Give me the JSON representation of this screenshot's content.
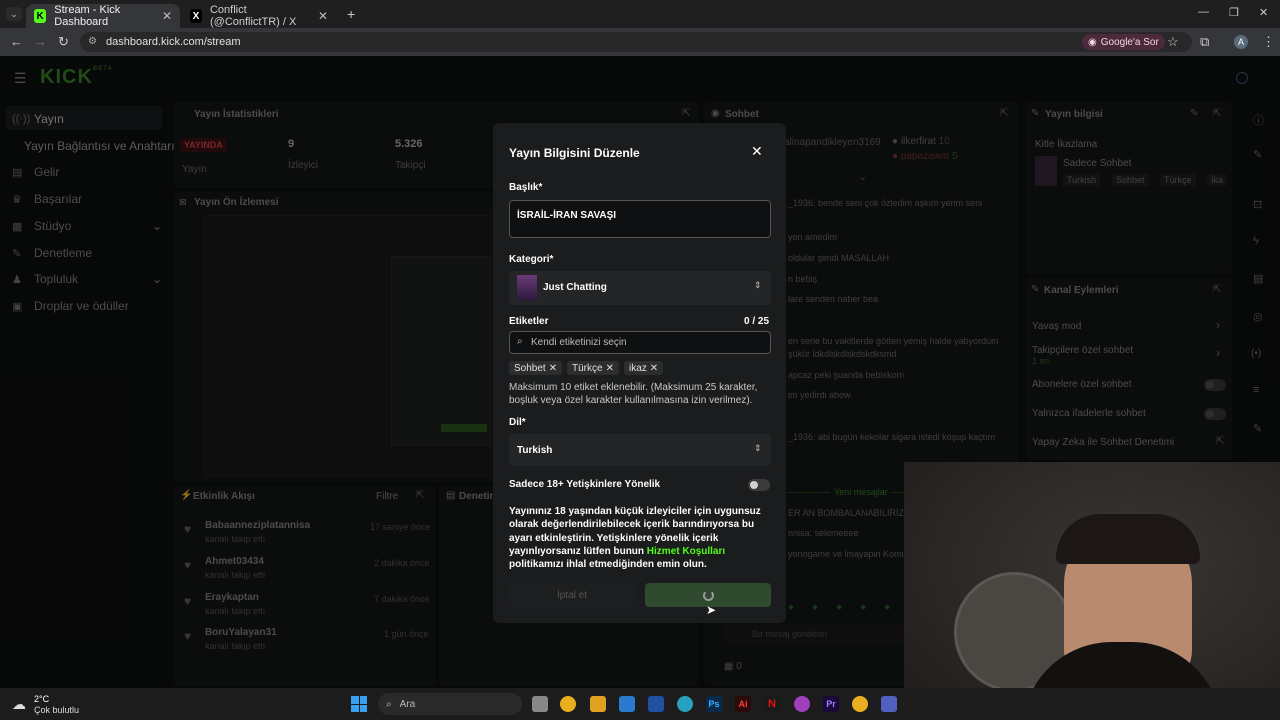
{
  "browser": {
    "tabs": [
      {
        "label": "Stream - Kick Dashboard",
        "icon": "kick-icon",
        "active": true
      },
      {
        "label": "Conflict (@ConflictTR) / X",
        "icon": "x-icon",
        "active": false
      }
    ],
    "url": "dashboard.kick.com/stream",
    "google_button": "Google'a Sor",
    "profile_letter": "A"
  },
  "app": {
    "logo": "KICK",
    "logo_badge": "BETA",
    "sidebar": {
      "items": [
        {
          "label": "Yayın",
          "icon": "broadcast-icon"
        },
        {
          "label": "Yayın Bağlantısı ve Anahtarı",
          "icon": ""
        },
        {
          "label": "Gelir",
          "icon": "money-icon"
        },
        {
          "label": "Başarılar",
          "icon": "trophy-icon"
        },
        {
          "label": "Stüdyo",
          "icon": "studio-icon",
          "chevron": true
        },
        {
          "label": "Denetleme",
          "icon": "wrench-icon"
        },
        {
          "label": "Topluluk",
          "icon": "community-icon",
          "chevron": true
        },
        {
          "label": "Droplar ve ödüller",
          "icon": "gift-icon"
        }
      ]
    },
    "stats": {
      "title": "Yayın İstatistikleri",
      "live_badge": "YAYINDA",
      "status_label": "Yayın",
      "viewers_value": "9",
      "viewers_label": "İzleyici",
      "followers_value": "5.326",
      "followers_label": "Takipçi"
    },
    "preview_title": "Yayın Ön İzlemesi",
    "activity": {
      "title": "Etkinlik Akışı",
      "filter": "Filtre",
      "items": [
        {
          "name": "Babaanneziplatannisa",
          "sub": "kanalı takip etti",
          "time": "17 saniye önce"
        },
        {
          "name": "Ahmet03434",
          "sub": "kanalı takip etti",
          "time": "2 dakika önce"
        },
        {
          "name": "Eraykaptan",
          "sub": "kanalı takip etti",
          "time": "7 dakika önce"
        },
        {
          "name": "BoruYalayan31",
          "sub": "kanalı takip etti",
          "time": "1 gün önce"
        }
      ]
    },
    "denetim_title": "Denetim",
    "chat": {
      "title": "Sohbet",
      "top_users": [
        {
          "name": "ilkerfirat",
          "count": "10"
        },
        {
          "name": "papazawm",
          "count": "5"
        }
      ],
      "partial_user": "alinapandikleyen3169",
      "lines": [
        "_1936: bende seni çok özledim aşkım yerim seni",
        "yon amedim",
        "oldular şimdi MASALLAH",
        "n bebiş",
        "lare senden naber bea",
        "en sene bu vakitlerde götten yemiş halde yabyordum",
        "şükür ldkdlskdlskdskdksmd",
        "apcaz peki şuanda bebiskom",
        "im yedirdi abow",
        "_1936: abi bugün kekolar sigara istedi koşup kaçtım"
      ],
      "new_messages": "Yeni mesajlar",
      "lines2": [
        "ER AN BOMBALANABİLİRİZ H",
        "nnisa: selemeeee",
        "yonogame ve lmayapin Komu"
      ],
      "input_placeholder": "Bir mesaj gönderin",
      "count": "0"
    },
    "stream_info": {
      "title": "Yayın bilgisi",
      "audience_label": "Kitle İkazlama",
      "name": "Sadece Sohbet",
      "tags": [
        "Turkish",
        "Sohbet",
        "Türkçe",
        "İka"
      ]
    },
    "channel_actions": {
      "title": "Kanal Eylemleri",
      "items": [
        {
          "label": "Yavaş mod",
          "type": "chevron"
        },
        {
          "label": "Takipçilere özel sohbet",
          "sub": "1 sn.",
          "type": "chevron"
        },
        {
          "label": "Abonelere özel sohbet",
          "type": "toggle"
        },
        {
          "label": "Yalnızca ifadelerle sohbet",
          "type": "toggle"
        },
        {
          "label": "Yapay Zeka ile Sohbet Denetimi",
          "type": "link"
        }
      ]
    }
  },
  "modal": {
    "title": "Yayın Bilgisini Düzenle",
    "title_label": "Başlık*",
    "title_value": "İSRAİL-İRAN SAVAŞI",
    "category_label": "Kategori*",
    "category_value": "Just Chatting",
    "tags_label": "Etiketler",
    "tags_count": "0 / 25",
    "tags_placeholder": "Kendi etiketinizi seçin",
    "tags": [
      "Sohbet",
      "Türkçe",
      "ikaz"
    ],
    "tags_help": "Maksimum 10 etiket eklenebilir. (Maksimum 25 karakter, boşluk veya özel karakter kullanılmasına izin verilmez).",
    "language_label": "Dil*",
    "language_value": "Turkish",
    "adult_label": "Sadece 18+ Yetişkinlere Yönelik",
    "adult_enabled": false,
    "adult_help_1": "Yayınınız 18 yaşından küçük izleyiciler için uygunsuz olarak değerlendirilebilecek içerik barındırıyorsa bu ayarı etkinleştirin. Yetişkinlere yönelik içerik yayınlıyorsanız lütfen bunun ",
    "adult_help_link": "Hizmet Koşulları",
    "adult_help_2": " politikamızı ihlal etmediğinden emin olun.",
    "cancel_button": "İptal et"
  },
  "taskbar": {
    "temperature": "2°C",
    "weather": "Çok bulutlu",
    "search_placeholder": "Ara"
  },
  "colors": {
    "kick_green": "#53fc18",
    "live_red": "#e0424b",
    "modal_bg": "#1b1c1d",
    "save_button": "#2f4a2f"
  }
}
